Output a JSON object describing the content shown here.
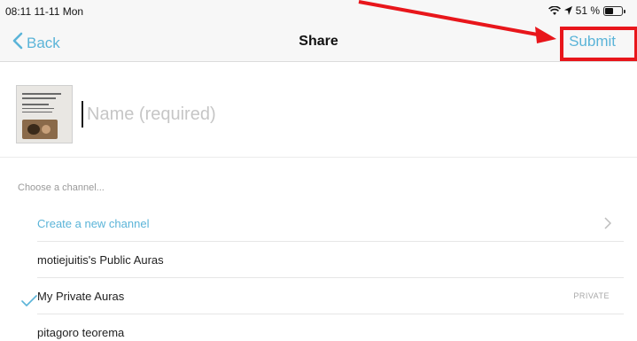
{
  "status_bar": {
    "time": "08:11  11-11 Mon",
    "battery": "51 %",
    "battery_level": 0.51
  },
  "nav": {
    "back_label": "Back",
    "title": "Share",
    "submit_label": "Submit"
  },
  "name_field": {
    "placeholder": "Name (required)",
    "value": ""
  },
  "channels": {
    "section_label": "Choose a channel...",
    "items": [
      {
        "label": "Create a new channel",
        "kind": "action",
        "icon": "chevron-right-icon"
      },
      {
        "label": "motiejuitis's Public Auras",
        "selected": false
      },
      {
        "label": "My Private Auras",
        "selected": true,
        "badge": "PRIVATE"
      },
      {
        "label": "pitagoro teorema",
        "selected": false
      }
    ]
  },
  "colors": {
    "accent": "#5bb4d8",
    "annotation": "#e8161b"
  }
}
